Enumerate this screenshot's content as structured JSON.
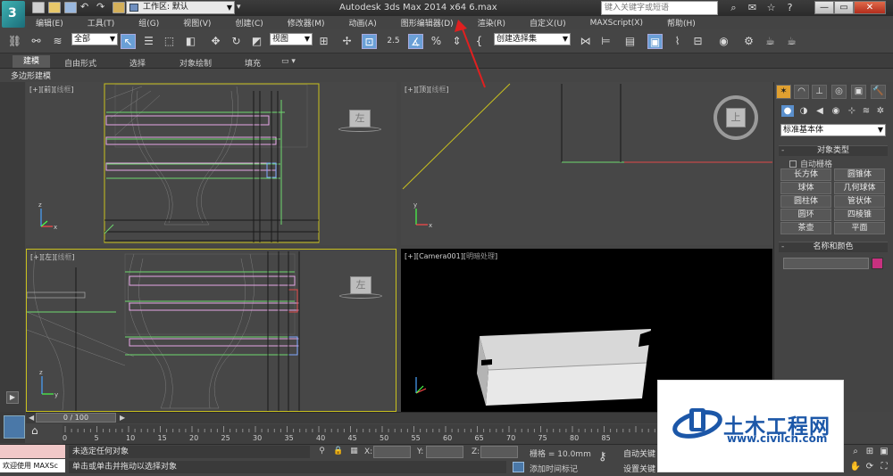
{
  "window": {
    "title": "Autodesk 3ds Max  2014 x64      6.max",
    "logo_text": "3",
    "workspace_label": "工作区: 默认",
    "help_search_placeholder": "键入关键字或短语",
    "min_label": "—",
    "max_label": "▭",
    "close_label": "✕"
  },
  "menu": [
    "编辑(E)",
    "工具(T)",
    "组(G)",
    "视图(V)",
    "创建(C)",
    "修改器(M)",
    "动画(A)",
    "图形编辑器(D)",
    "渲染(R)",
    "自定义(U)",
    "MAXScript(X)",
    "帮助(H)"
  ],
  "toolbar": {
    "selection_filter": "全部",
    "reference_coord": "视图",
    "snap_value": "2.5",
    "named_selection": "创建选择集"
  },
  "ribbon": {
    "tabs": [
      "建模",
      "自由形式",
      "选择",
      "对象绘制",
      "填充"
    ],
    "active_tab": "建模",
    "subpanel_label": "多边形建模"
  },
  "viewports": {
    "front": {
      "label": "[+][",
      "view": "前",
      "shade": "线框",
      "close": "]"
    },
    "top": {
      "label": "[+][",
      "view": "顶",
      "shade": "线框",
      "close": "]"
    },
    "left": {
      "label": "[+][",
      "view": "左",
      "shade": "线框",
      "close": "]"
    },
    "camera": {
      "label": "[+][Camera001][",
      "shade": "明暗处理",
      "close": "]"
    },
    "viewcube_front": "左",
    "viewcube_top": "上",
    "viewcube_left": "左"
  },
  "command_panel": {
    "category_dropdown": "标准基本体",
    "object_type_header": "对象类型",
    "autogrid_label": "自动栅格",
    "buttons": [
      "长方体",
      "圆锥体",
      "球体",
      "几何球体",
      "圆柱体",
      "管状体",
      "圆环",
      "四棱锥",
      "茶壶",
      "平面"
    ],
    "name_color_header": "名称和颜色",
    "object_color": "#c8317f"
  },
  "timeline": {
    "slider_label": "0 / 100",
    "ticks": [
      "0",
      "5",
      "10",
      "15",
      "20",
      "25",
      "30",
      "35",
      "40",
      "45",
      "50",
      "55",
      "60",
      "65",
      "70",
      "75",
      "80",
      "85"
    ],
    "current_frame": 0,
    "total_frames": 100
  },
  "status": {
    "maxscript_welcome": "欢迎使用 MAXSc",
    "line1": "未选定任何对象",
    "line2": "单击或单击并拖动以选择对象",
    "x_label": "X:",
    "y_label": "Y:",
    "z_label": "Z:",
    "grid": "栅格 = 10.0mm",
    "add_time_tag": "添加时间标记",
    "auto_key": "自动关键",
    "set_key": "设置关键"
  },
  "watermark": {
    "title": "土木工程网",
    "url": "www.civilcn.com"
  }
}
